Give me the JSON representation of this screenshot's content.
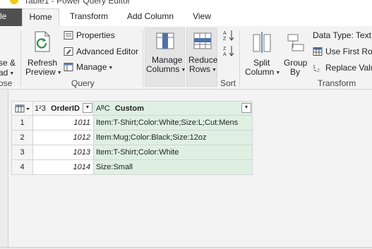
{
  "window": {
    "title": "Table1 - Power Query Editor"
  },
  "tabs": {
    "file": "le",
    "home": "Home",
    "transform": "Transform",
    "add_column": "Add Column",
    "view": "View"
  },
  "ribbon": {
    "close_apply": {
      "line1": "se &",
      "line2": "ad"
    },
    "close_group_label": "ose",
    "refresh": {
      "line1": "Refresh",
      "line2": "Preview"
    },
    "properties": "Properties",
    "advanced_editor": "Advanced Editor",
    "manage": "Manage",
    "query_group_label": "Query",
    "manage_columns": {
      "line1": "Manage",
      "line2": "Columns"
    },
    "reduce_rows": {
      "line1": "Reduce",
      "line2": "Rows"
    },
    "sort_group_label": "Sort",
    "split_column": {
      "line1": "Split",
      "line2": "Column"
    },
    "group_by": {
      "line1": "Group",
      "line2": "By"
    },
    "data_type": "Data Type: Text",
    "use_first_row": "Use First Row",
    "replace_values": "Replace Valu",
    "transform_group_label": "Transform"
  },
  "table": {
    "columns": [
      {
        "type_icon": "1²3",
        "name": "OrderID"
      },
      {
        "type_icon": "AᴮC",
        "name": "Custom"
      }
    ],
    "rows": [
      {
        "num": "1",
        "order_id": "1011",
        "custom": "Item:T-Shirt;Color:White;Size:L;Cut:Mens"
      },
      {
        "num": "2",
        "order_id": "1012",
        "custom": "Item:Mug;Color:Black;Size:12oz"
      },
      {
        "num": "3",
        "order_id": "1013",
        "custom": "Item:T-Shirt;Color:White"
      },
      {
        "num": "4",
        "order_id": "1014",
        "custom": "Size:Small"
      }
    ]
  },
  "colors": {
    "selected_column": "#dff0e3",
    "file_tab": "#505050",
    "accent": "#f2c811"
  }
}
